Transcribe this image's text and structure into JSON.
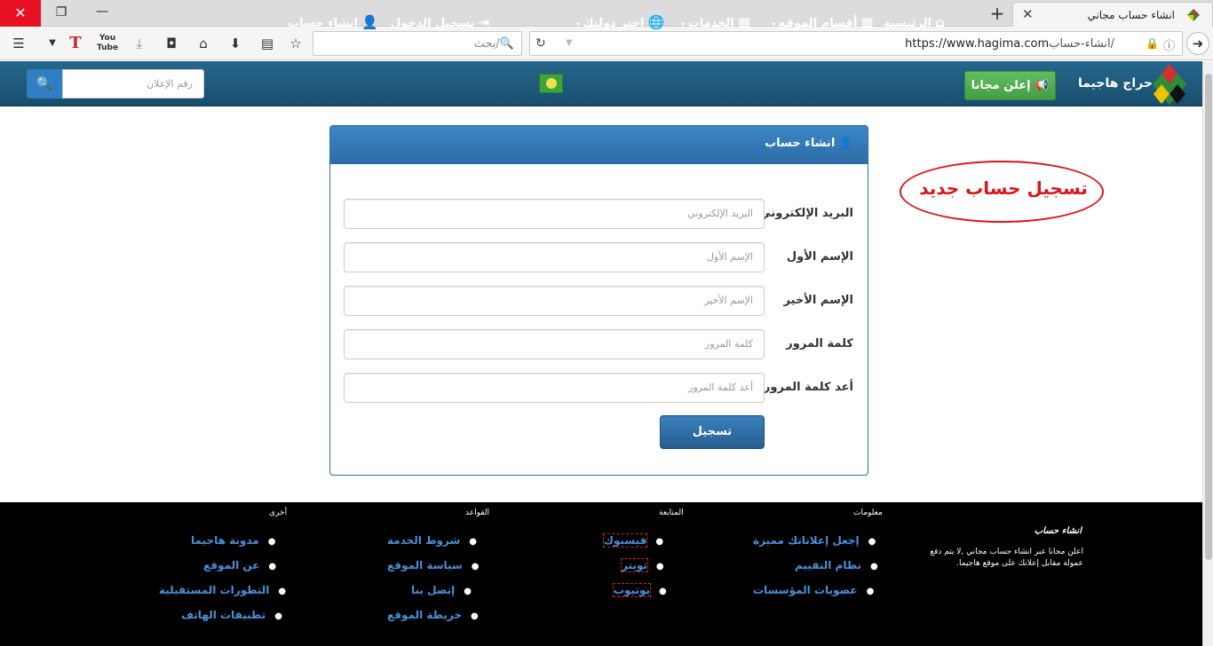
{
  "browser": {
    "tab_title": "انشاء حساب مجاني",
    "url_path": "انشاء-حساب/",
    "url_domain": "https://www.hagima.com",
    "search_placeholder": "بحث",
    "icons": [
      "close-icon",
      "restore-icon",
      "minimize-icon",
      "plus-icon",
      "menu-icon",
      "dropdown-icon",
      "text-icon",
      "youtube-icon",
      "download-icon",
      "pocket-icon",
      "home-icon",
      "arrow-down-icon",
      "clipboard-icon",
      "star-icon",
      "search-icon",
      "reload-icon",
      "lock-icon",
      "info-icon",
      "back-icon"
    ]
  },
  "site_header": {
    "logo_text": "حراج هاجيما",
    "post_ad_label": "إعلن مجانا",
    "nav": {
      "home": "الرئيسية",
      "sections": "أقسام الموقع",
      "services": "الخدمات",
      "country": "اختر دولتك",
      "login": "تسجيل الدخول",
      "register": "انشاء حساب"
    },
    "ad_search_placeholder": "رقم الإعلان"
  },
  "form": {
    "title": "انشاء حساب",
    "fields": [
      {
        "label": "البريد الإلكتروني",
        "placeholder": "البريد الإلكتروني"
      },
      {
        "label": "الإسم الأول",
        "placeholder": "الإسم الأول"
      },
      {
        "label": "الإسم الأخير",
        "placeholder": "الإسم الأخير"
      },
      {
        "label": "كلمة المرور",
        "placeholder": "كلمة المرور"
      },
      {
        "label": "أعد كلمة المرور",
        "placeholder": "أعد كلمة المرور"
      }
    ],
    "submit_label": "تسجيل"
  },
  "annotation": {
    "text": "تسجيل حساب جديد",
    "color": "#d8161c"
  },
  "footer": {
    "about": {
      "title": "انشاء حساب",
      "text": "اعلن مجانا عبر انشاء حساب مجاني ,لا يتم دفع عمولة مقابل إعلانك على موقع هاجيما."
    },
    "columns": [
      {
        "title": "معلومات",
        "links": [
          "إجعل إعلاناتك مميزة",
          "نظام التقييم",
          "عضويات المؤسسات"
        ]
      },
      {
        "title": "المتابعة",
        "links": [
          "فيسبوك",
          "تويتر",
          "يوتيوب"
        ]
      },
      {
        "title": "القواعد",
        "links": [
          "شروط الخدمة",
          "سياسة الموقع",
          "إتصل بنا",
          "خريطة الموقع"
        ]
      },
      {
        "title": "أخرى",
        "links": [
          "مدونة هاجيما",
          "عن الموقع",
          "التطورات المستقبلية",
          "تطبيقات الهاتف"
        ]
      }
    ]
  },
  "colors": {
    "header_bg": "#1e5b7d",
    "panel_header": "#337ab7",
    "post_button": "#4cae4c",
    "footer_bg": "#000000",
    "footer_link": "#4a90d9"
  }
}
